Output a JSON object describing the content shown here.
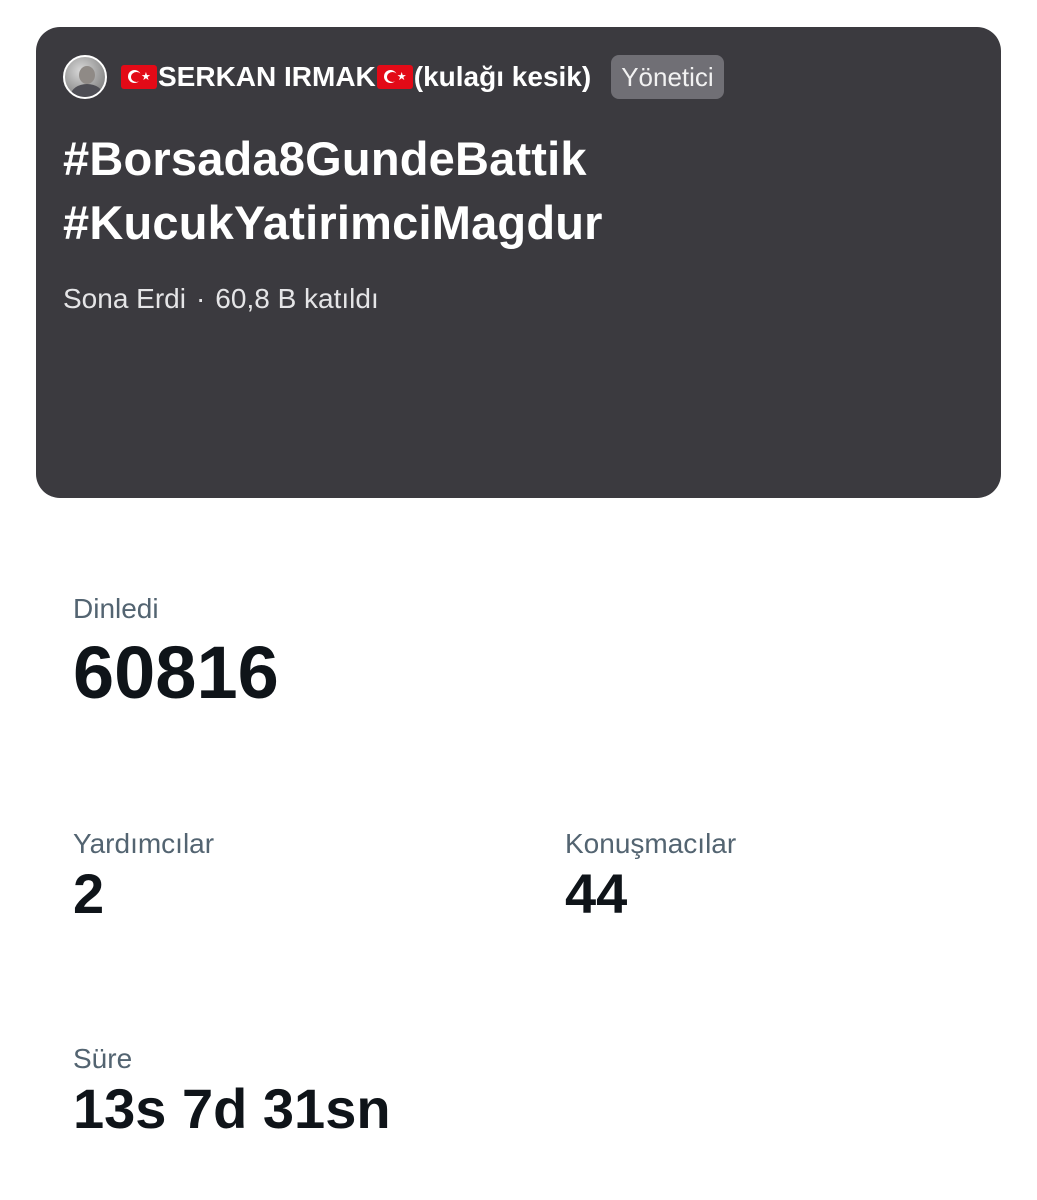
{
  "space": {
    "host": {
      "name": "SERKAN IRMAK",
      "suffix": "(kulağı kesik)",
      "role": "Yönetici"
    },
    "title_lines": [
      "#Borsada8GundeBattik",
      "#KucukYatirimciMagdur"
    ],
    "status": "Sona Erdi",
    "separator": "·",
    "joined": "60,8 B katıldı"
  },
  "stats": {
    "listened": {
      "label": "Dinledi",
      "value": "60816"
    },
    "cohosts": {
      "label": "Yardımcılar",
      "value": "2"
    },
    "speakers": {
      "label": "Konuşmacılar",
      "value": "44"
    },
    "duration": {
      "label": "Süre",
      "value": "13s 7d 31sn"
    }
  },
  "colors": {
    "card_bg": "#3b3a3f",
    "badge_bg": "#706f75",
    "label": "#536471",
    "value": "#0f1419",
    "flag_red": "#e30a17"
  }
}
